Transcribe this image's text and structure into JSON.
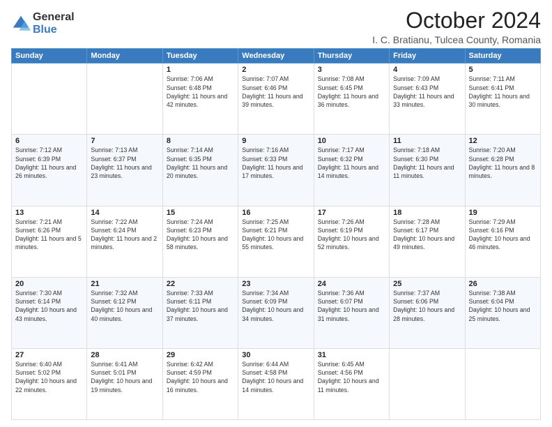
{
  "logo": {
    "general": "General",
    "blue": "Blue"
  },
  "header": {
    "month": "October 2024",
    "location": "I. C. Bratianu, Tulcea County, Romania"
  },
  "weekdays": [
    "Sunday",
    "Monday",
    "Tuesday",
    "Wednesday",
    "Thursday",
    "Friday",
    "Saturday"
  ],
  "weeks": [
    [
      {
        "day": "",
        "info": ""
      },
      {
        "day": "",
        "info": ""
      },
      {
        "day": "1",
        "info": "Sunrise: 7:06 AM\nSunset: 6:48 PM\nDaylight: 11 hours and 42 minutes."
      },
      {
        "day": "2",
        "info": "Sunrise: 7:07 AM\nSunset: 6:46 PM\nDaylight: 11 hours and 39 minutes."
      },
      {
        "day": "3",
        "info": "Sunrise: 7:08 AM\nSunset: 6:45 PM\nDaylight: 11 hours and 36 minutes."
      },
      {
        "day": "4",
        "info": "Sunrise: 7:09 AM\nSunset: 6:43 PM\nDaylight: 11 hours and 33 minutes."
      },
      {
        "day": "5",
        "info": "Sunrise: 7:11 AM\nSunset: 6:41 PM\nDaylight: 11 hours and 30 minutes."
      }
    ],
    [
      {
        "day": "6",
        "info": "Sunrise: 7:12 AM\nSunset: 6:39 PM\nDaylight: 11 hours and 26 minutes."
      },
      {
        "day": "7",
        "info": "Sunrise: 7:13 AM\nSunset: 6:37 PM\nDaylight: 11 hours and 23 minutes."
      },
      {
        "day": "8",
        "info": "Sunrise: 7:14 AM\nSunset: 6:35 PM\nDaylight: 11 hours and 20 minutes."
      },
      {
        "day": "9",
        "info": "Sunrise: 7:16 AM\nSunset: 6:33 PM\nDaylight: 11 hours and 17 minutes."
      },
      {
        "day": "10",
        "info": "Sunrise: 7:17 AM\nSunset: 6:32 PM\nDaylight: 11 hours and 14 minutes."
      },
      {
        "day": "11",
        "info": "Sunrise: 7:18 AM\nSunset: 6:30 PM\nDaylight: 11 hours and 11 minutes."
      },
      {
        "day": "12",
        "info": "Sunrise: 7:20 AM\nSunset: 6:28 PM\nDaylight: 11 hours and 8 minutes."
      }
    ],
    [
      {
        "day": "13",
        "info": "Sunrise: 7:21 AM\nSunset: 6:26 PM\nDaylight: 11 hours and 5 minutes."
      },
      {
        "day": "14",
        "info": "Sunrise: 7:22 AM\nSunset: 6:24 PM\nDaylight: 11 hours and 2 minutes."
      },
      {
        "day": "15",
        "info": "Sunrise: 7:24 AM\nSunset: 6:23 PM\nDaylight: 10 hours and 58 minutes."
      },
      {
        "day": "16",
        "info": "Sunrise: 7:25 AM\nSunset: 6:21 PM\nDaylight: 10 hours and 55 minutes."
      },
      {
        "day": "17",
        "info": "Sunrise: 7:26 AM\nSunset: 6:19 PM\nDaylight: 10 hours and 52 minutes."
      },
      {
        "day": "18",
        "info": "Sunrise: 7:28 AM\nSunset: 6:17 PM\nDaylight: 10 hours and 49 minutes."
      },
      {
        "day": "19",
        "info": "Sunrise: 7:29 AM\nSunset: 6:16 PM\nDaylight: 10 hours and 46 minutes."
      }
    ],
    [
      {
        "day": "20",
        "info": "Sunrise: 7:30 AM\nSunset: 6:14 PM\nDaylight: 10 hours and 43 minutes."
      },
      {
        "day": "21",
        "info": "Sunrise: 7:32 AM\nSunset: 6:12 PM\nDaylight: 10 hours and 40 minutes."
      },
      {
        "day": "22",
        "info": "Sunrise: 7:33 AM\nSunset: 6:11 PM\nDaylight: 10 hours and 37 minutes."
      },
      {
        "day": "23",
        "info": "Sunrise: 7:34 AM\nSunset: 6:09 PM\nDaylight: 10 hours and 34 minutes."
      },
      {
        "day": "24",
        "info": "Sunrise: 7:36 AM\nSunset: 6:07 PM\nDaylight: 10 hours and 31 minutes."
      },
      {
        "day": "25",
        "info": "Sunrise: 7:37 AM\nSunset: 6:06 PM\nDaylight: 10 hours and 28 minutes."
      },
      {
        "day": "26",
        "info": "Sunrise: 7:38 AM\nSunset: 6:04 PM\nDaylight: 10 hours and 25 minutes."
      }
    ],
    [
      {
        "day": "27",
        "info": "Sunrise: 6:40 AM\nSunset: 5:02 PM\nDaylight: 10 hours and 22 minutes."
      },
      {
        "day": "28",
        "info": "Sunrise: 6:41 AM\nSunset: 5:01 PM\nDaylight: 10 hours and 19 minutes."
      },
      {
        "day": "29",
        "info": "Sunrise: 6:42 AM\nSunset: 4:59 PM\nDaylight: 10 hours and 16 minutes."
      },
      {
        "day": "30",
        "info": "Sunrise: 6:44 AM\nSunset: 4:58 PM\nDaylight: 10 hours and 14 minutes."
      },
      {
        "day": "31",
        "info": "Sunrise: 6:45 AM\nSunset: 4:56 PM\nDaylight: 10 hours and 11 minutes."
      },
      {
        "day": "",
        "info": ""
      },
      {
        "day": "",
        "info": ""
      }
    ]
  ]
}
